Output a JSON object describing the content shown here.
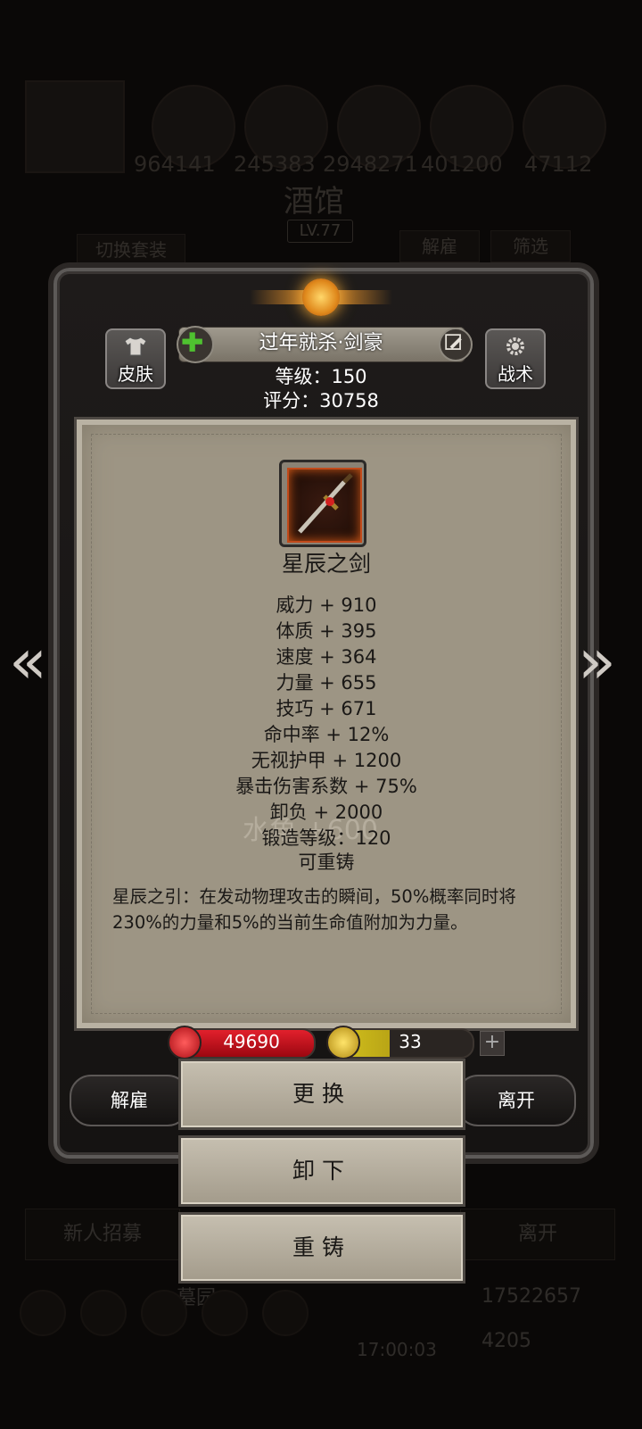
{
  "background": {
    "stats": [
      "964141",
      "245383",
      "2948271",
      "401200",
      "47112"
    ],
    "title": "酒馆",
    "level": "LV.77",
    "switch_set": "切换套装",
    "dismiss": "解雇",
    "filter": "筛选",
    "recruit": "新人招募",
    "leave": "离开",
    "cemetery": "墓园",
    "gold": "17522657",
    "gems": "4205",
    "timer": "17:00:03"
  },
  "hero": {
    "skin_label": "皮肤",
    "tactics_label": "战术",
    "name": "过年就杀·剑豪",
    "level_text": "等级：150",
    "score_text": "评分：30758"
  },
  "item": {
    "name": "星辰之剑",
    "stats": [
      "威力 + 910",
      "体质 + 395",
      "速度 + 364",
      "力量 + 655",
      "技巧 + 671",
      "命中率 + 12%",
      "无视护甲 + 1200",
      "暴击伤害系数 + 75%",
      "卸负 + 2000",
      "锻造等级：120"
    ],
    "reforgeable": "可重铸",
    "watermark": "水角 +600",
    "description": "星辰之引：在发动物理攻击的瞬间，50%概率同时将230%的力量和5%的当前生命值附加为力量。"
  },
  "resources": {
    "hp": "49690",
    "energy": "33",
    "energy_fill": 0.42,
    "plus": "+"
  },
  "actions": {
    "dismiss": "解雇",
    "replace": "更换",
    "unequip": "卸下",
    "reforge": "重铸",
    "leave": "离开"
  },
  "colors": {
    "hp": "#e2202c",
    "energy": "#d7c51e",
    "parchment": "#9d9584"
  }
}
